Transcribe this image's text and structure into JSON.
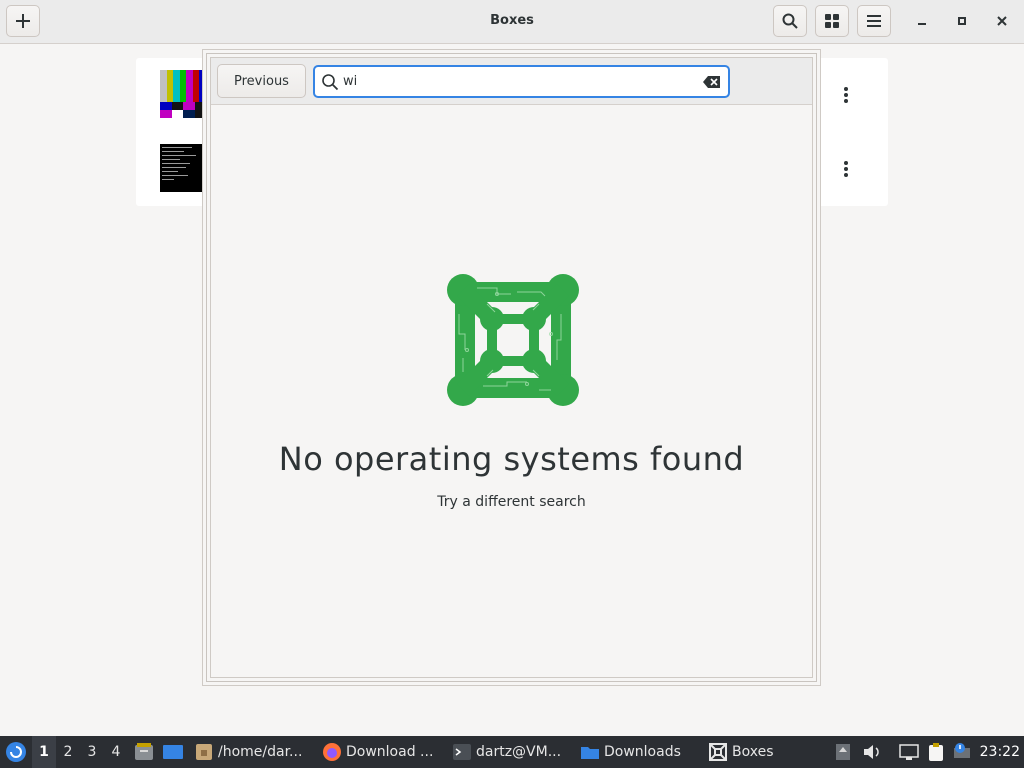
{
  "header": {
    "title": "Boxes",
    "new_button_icon": "plus-icon",
    "search_button_icon": "search-icon",
    "view_button_icon": "grid-icon",
    "menu_button_icon": "hamburger-icon"
  },
  "window_controls": {
    "minimize": "minimize-icon",
    "maximize": "maximize-icon",
    "close": "close-icon"
  },
  "machines": [
    {
      "thumbnail": "test-pattern-thumbnail",
      "menu_icon": "kebab-menu-icon"
    },
    {
      "thumbnail": "terminal-thumbnail",
      "menu_icon": "kebab-menu-icon"
    }
  ],
  "dialog": {
    "previous_label": "Previous",
    "search": {
      "value": "wi",
      "placeholder": ""
    },
    "empty_title": "No operating systems found",
    "empty_subtitle": "Try a different search",
    "logo_color": "#33a84a"
  },
  "taskbar": {
    "workspaces": [
      "1",
      "2",
      "3",
      "4"
    ],
    "active_workspace": "1",
    "tasks": [
      {
        "label": "/home/dar...",
        "icon": "file-manager-icon"
      },
      {
        "label": "Download ...",
        "icon": "firefox-icon"
      },
      {
        "label": "dartz@VM...",
        "icon": "terminal-icon"
      },
      {
        "label": "Downloads",
        "icon": "folder-icon"
      },
      {
        "label": "Boxes",
        "icon": "boxes-icon"
      }
    ],
    "clock": "23:22",
    "colors": {
      "background": "#2b2e33",
      "accent": "#3584e4"
    }
  }
}
